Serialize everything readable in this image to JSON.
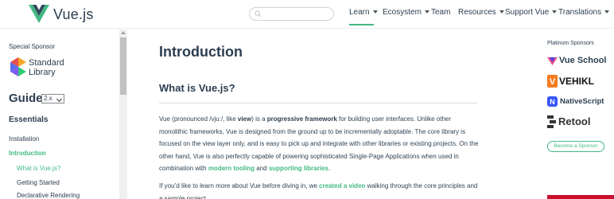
{
  "header": {
    "brand": "Vue.js",
    "search": {
      "placeholder": ""
    },
    "nav": [
      {
        "label": "Learn",
        "has_caret": true,
        "active": true
      },
      {
        "label": "Ecosystem",
        "has_caret": true,
        "active": false
      },
      {
        "label": "Team",
        "has_caret": false,
        "active": false
      },
      {
        "label": "Resources",
        "has_caret": true,
        "active": false
      },
      {
        "label": "Support Vue",
        "has_caret": true,
        "active": false
      },
      {
        "label": "Translations",
        "has_caret": true,
        "active": false
      }
    ]
  },
  "sidebar": {
    "special_sponsor_label": "Special Sponsor",
    "sponsor_name_line1": "Standard",
    "sponsor_name_line2": "Library",
    "guide_title": "Guide",
    "version": "2.x",
    "section": "Essentials",
    "links": [
      {
        "label": "Installation",
        "state": "normal"
      },
      {
        "label": "Introduction",
        "state": "current"
      },
      {
        "label": "What is Vue.js?",
        "state": "sub-active"
      },
      {
        "label": "Getting Started",
        "state": "sub"
      },
      {
        "label": "Declarative Rendering",
        "state": "sub"
      }
    ]
  },
  "main": {
    "title": "Introduction",
    "heading": "What is Vue.js?",
    "p1": {
      "t1": "Vue (pronounced /vjuː/, like ",
      "b1": "view",
      "t2": ") is a ",
      "b2": "progressive framework",
      "t3": " for building user interfaces. Unlike other monolithic frameworks, Vue is designed from the ground up to be incrementally adoptable. The core library is focused on the view layer only, and is easy to pick up and integrate with other libraries or existing projects. On the other hand, Vue is also perfectly capable of powering sophisticated Single-Page Applications when used in combination with ",
      "l1": "modern tooling",
      "t4": " and ",
      "l2": "supporting libraries",
      "t5": "."
    },
    "p2": {
      "t1": "If you’d like to learn more about Vue before diving in, we ",
      "l1": "created a video",
      "t2": " walking through the core principles and a sample project."
    }
  },
  "right": {
    "platinum_label": "Platinum Sponsors",
    "sponsors": [
      "Vue School",
      "VEHIKL",
      "NativeScript",
      "Retool"
    ],
    "become_label": "Become a Sponsor"
  },
  "colors": {
    "accent": "#42b983",
    "text": "#2c3e50"
  }
}
